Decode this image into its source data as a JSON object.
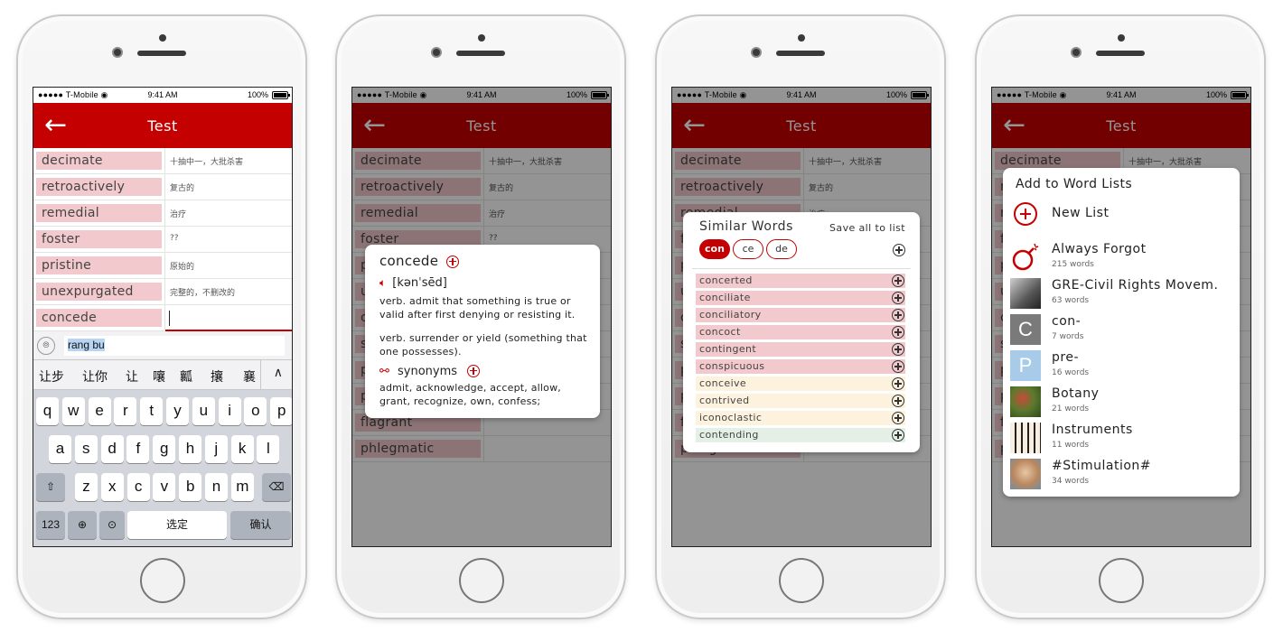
{
  "status": {
    "carrier": "●●●●● T-Mobile ◉",
    "time": "9:41 AM",
    "battery": "100%"
  },
  "header": {
    "title": "Test"
  },
  "words": [
    {
      "word": "decimate",
      "meaning": "十抽中一，大批杀害"
    },
    {
      "word": "retroactively",
      "meaning": "复古的"
    },
    {
      "word": "remedial",
      "meaning": "治疗"
    },
    {
      "word": "foster",
      "meaning": "??"
    },
    {
      "word": "pristine",
      "meaning": "原始的"
    },
    {
      "word": "unexpurgated",
      "meaning": "完整的，不删改的"
    },
    {
      "word": "concede",
      "meaning": ""
    }
  ],
  "background_words": [
    "surfeit",
    "peculiar",
    "palatable",
    "flagrant",
    "phlegmatic"
  ],
  "keyboard": {
    "pinyin": "rang bu",
    "candidates": [
      "让步",
      "让你",
      "让",
      "嚷",
      "瓤",
      "攘",
      "襄"
    ],
    "row1": [
      "q",
      "w",
      "e",
      "r",
      "t",
      "y",
      "u",
      "i",
      "o",
      "p"
    ],
    "row2": [
      "a",
      "s",
      "d",
      "f",
      "g",
      "h",
      "j",
      "k",
      "l"
    ],
    "row3": [
      "z",
      "x",
      "c",
      "v",
      "b",
      "n",
      "m"
    ],
    "num_label": "123",
    "space_label": "选定",
    "confirm_label": "确认"
  },
  "definition": {
    "word": "concede",
    "phonetic": "[kənˈsēd]",
    "sense1": "verb. admit that something is true or valid after first denying or resisting it.",
    "sense2": "verb. surrender or yield (something that one possesses).",
    "synonyms_label": "synonyms",
    "synonyms": "admit, acknowledge, accept, allow, grant, recognize, own, confess;"
  },
  "similar": {
    "title": "Similar Words",
    "save_all": "Save all to list",
    "chips": [
      "con",
      "ce",
      "de"
    ],
    "items": [
      {
        "word": "concerted",
        "color": "#f2c9cc"
      },
      {
        "word": "conciliate",
        "color": "#f2c9cc"
      },
      {
        "word": "conciliatory",
        "color": "#f2c9cc"
      },
      {
        "word": "concoct",
        "color": "#f2c9cc"
      },
      {
        "word": "contingent",
        "color": "#f2c9cc"
      },
      {
        "word": "conspicuous",
        "color": "#f2c9cc"
      },
      {
        "word": "conceive",
        "color": "#fdf2de"
      },
      {
        "word": "contrived",
        "color": "#fdf2de"
      },
      {
        "word": "iconoclastic",
        "color": "#fdf2de"
      },
      {
        "word": "contending",
        "color": "#e4f0e6"
      }
    ]
  },
  "word_lists": {
    "title": "Add to Word Lists",
    "new_list": "New List",
    "lists": [
      {
        "name": "Always Forgot",
        "count": "215 words",
        "icon": "bomb-icon"
      },
      {
        "name": "GRE-Civil Rights Movem.",
        "count": "63 words",
        "icon": "portrait-thumb"
      },
      {
        "name": "con-",
        "count": "7 words",
        "icon": "letter-c",
        "letter": "C"
      },
      {
        "name": "pre-",
        "count": "16 words",
        "icon": "letter-p",
        "letter": "P"
      },
      {
        "name": "Botany",
        "count": "21 words",
        "icon": "botany-thumb"
      },
      {
        "name": "Instruments",
        "count": "11 words",
        "icon": "piano-thumb"
      },
      {
        "name": "#Stimulation#",
        "count": "34 words",
        "icon": "baby-thumb"
      }
    ]
  },
  "colors": {
    "accent": "#c40000",
    "word_bg": "#f2c9cc",
    "letter_c_bg": "#7a7a7a",
    "letter_p_bg": "#a8cbe9"
  }
}
